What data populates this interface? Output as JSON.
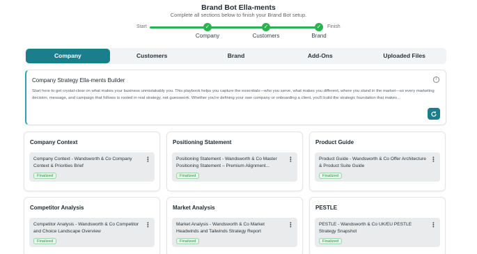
{
  "header": {
    "title": "Brand Bot Ella-ments",
    "subtitle": "Complete all sections below to finish your Brand Bot setup."
  },
  "progress": {
    "start_label": "Start",
    "finish_label": "Finish",
    "check_glyph": "✓",
    "steps": [
      {
        "label": "Company",
        "status": "complete"
      },
      {
        "label": "Customers",
        "status": "complete"
      },
      {
        "label": "Brand",
        "status": "complete"
      }
    ],
    "accent_color": "#2bb24c"
  },
  "tabs": [
    {
      "label": "Company",
      "active": true
    },
    {
      "label": "Customers",
      "active": false
    },
    {
      "label": "Brand",
      "active": false
    },
    {
      "label": "Add-Ons",
      "active": false
    },
    {
      "label": "Uploaded Files",
      "active": false
    }
  ],
  "builder": {
    "title": "Company Strategy Ella-ments Builder",
    "description": "Start here to get crystal-clear on what makes your business unmistakably you. This playbook helps you capture the essentials—who you serve, what makes you different, where you stand in the market—so every marketing decision, message, and campaign that follows is rooted in real strategy, not guesswork. Whether you're defining your own company or onboarding a client, you'll build the strategic foundation that makes...",
    "info_icon": "info-icon",
    "action_icon": "refresh-icon"
  },
  "cards": [
    {
      "title": "Company Context",
      "doc": "Company Context - Wandsworth & Co Company Context & Priorities Brief",
      "status": "Finalized"
    },
    {
      "title": "Positioning Statement",
      "doc": "Positioning Statement - Wandsworth & Co Master Positioning Statement – Premium Alignment...",
      "status": "Finalized"
    },
    {
      "title": "Product Guide",
      "doc": "Product Guide - Wandsworth & Co Offer Architecture & Product Suite Guide",
      "status": "Finalized"
    },
    {
      "title": "Competitor Analysis",
      "doc": "Competitor Analysis - Wandsworth & Co Competitor and Choice Landscape Overview",
      "status": "Finalized"
    },
    {
      "title": "Market Analysis",
      "doc": "Market Analysis - Wandsworth & Co Market Headwinds and Tailwinds Strategy Report",
      "status": "Finalized"
    },
    {
      "title": "PESTLE",
      "doc": "PESTLE - Wandsworth & Co UK/EU PESTLE Strategy Snapshot",
      "status": "Finalized"
    }
  ],
  "colors": {
    "primary": "#1b7e8c",
    "success": "#2bb24c"
  }
}
